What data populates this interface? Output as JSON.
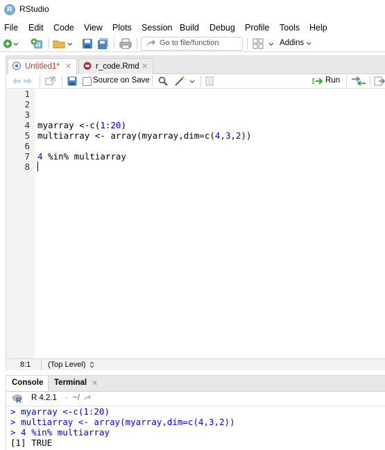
{
  "window": {
    "title": "RStudio",
    "logo_letter": "R"
  },
  "menu": [
    "File",
    "Edit",
    "Code",
    "View",
    "Plots",
    "Session",
    "Build",
    "Debug",
    "Profile",
    "Tools",
    "Help"
  ],
  "toolbar": {
    "goto_placeholder": "Go to file/function",
    "addins_label": "Addins"
  },
  "editor": {
    "tabs": [
      {
        "label": "Untitled1*",
        "active": true
      },
      {
        "label": "r_code.Rmd",
        "active": false
      }
    ],
    "source_on_save_label": "Source on Save",
    "run_label": "Run",
    "line_numbers": [
      "1",
      "2",
      "3",
      "4",
      "5",
      "6",
      "7",
      "8"
    ],
    "lines": [
      {
        "parts": []
      },
      {
        "parts": []
      },
      {
        "parts": []
      },
      {
        "parts": [
          {
            "t": "myarray <-c("
          },
          {
            "t": "1",
            "num": true
          },
          {
            "t": ":"
          },
          {
            "t": "20",
            "num": true
          },
          {
            "t": ")"
          }
        ]
      },
      {
        "parts": [
          {
            "t": "multiarray <- array(myarray,dim=c("
          },
          {
            "t": "4",
            "num": true
          },
          {
            "t": ","
          },
          {
            "t": "3",
            "num": true
          },
          {
            "t": ","
          },
          {
            "t": "2",
            "num": true
          },
          {
            "t": "))"
          }
        ]
      },
      {
        "parts": []
      },
      {
        "parts": [
          {
            "t": "4",
            "num": true
          },
          {
            "t": " %in% multiarray"
          }
        ]
      },
      {
        "parts": []
      }
    ],
    "status_position": "8:1",
    "status_scope": "(Top Level)"
  },
  "console": {
    "tabs": [
      "Console",
      "Terminal"
    ],
    "r_version": "R 4.2.1",
    "working_dir": "~/",
    "lines": [
      {
        "text": "> myarray <-c(1:20)",
        "type": "input"
      },
      {
        "text": "> multiarray <- array(myarray,dim=c(4,3,2))",
        "type": "input"
      },
      {
        "text": "> 4 %in% multiarray",
        "type": "input"
      },
      {
        "text": "[1] TRUE",
        "type": "output"
      }
    ]
  },
  "colors": {
    "input": "#0000ff",
    "output": "#000000",
    "active_tab_text": "#c0392b",
    "accent_blue": "#4a86c5"
  }
}
